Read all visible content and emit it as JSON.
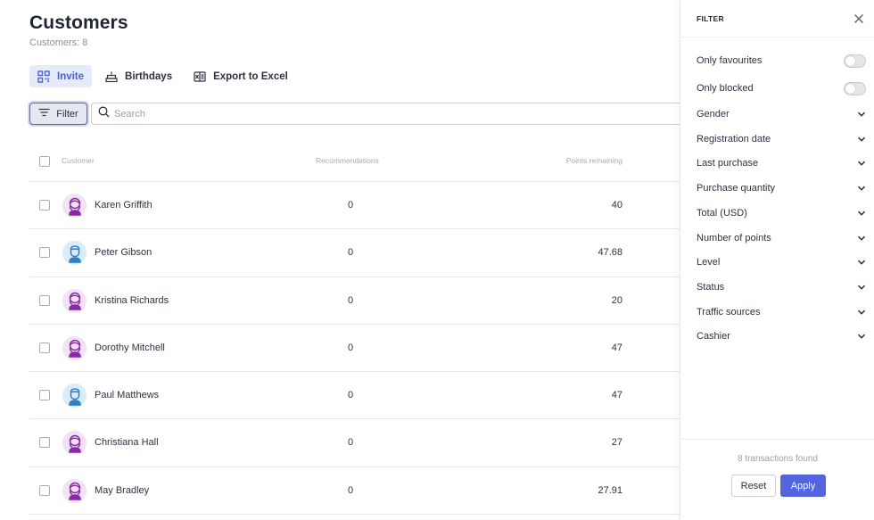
{
  "header": {
    "title": "Customers",
    "subtitle": "Customers: 8"
  },
  "toolbar": {
    "invite_label": "Invite",
    "birthdays_label": "Birthdays",
    "export_label": "Export to Excel"
  },
  "filter_button": {
    "label": "Filter"
  },
  "search": {
    "placeholder": "Search",
    "value": ""
  },
  "table": {
    "columns": [
      "Customer",
      "Recommendations",
      "Points remaining"
    ],
    "rows": [
      {
        "name": "Karen Griffith",
        "recommendations": "0",
        "points": "40",
        "avatar": "female-avatar-icon"
      },
      {
        "name": "Peter Gibson",
        "recommendations": "0",
        "points": "47.68",
        "avatar": "male-avatar-icon"
      },
      {
        "name": "Kristina Richards",
        "recommendations": "0",
        "points": "20",
        "avatar": "female-avatar-icon"
      },
      {
        "name": "Dorothy Mitchell",
        "recommendations": "0",
        "points": "47",
        "avatar": "female-avatar-icon"
      },
      {
        "name": "Paul Matthews",
        "recommendations": "0",
        "points": "47",
        "avatar": "male-avatar-icon"
      },
      {
        "name": "Christiana Hall",
        "recommendations": "0",
        "points": "27",
        "avatar": "female-avatar-icon"
      },
      {
        "name": "May Bradley",
        "recommendations": "0",
        "points": "27.91",
        "avatar": "female-avatar-icon"
      }
    ]
  },
  "filter_panel": {
    "title": "FILTER",
    "toggles": [
      {
        "label": "Only favourites",
        "on": false
      },
      {
        "label": "Only blocked",
        "on": false
      }
    ],
    "sections": [
      "Gender",
      "Registration date",
      "Last purchase",
      "Purchase quantity",
      "Total (USD)",
      "Number of points",
      "Level",
      "Status",
      "Traffic sources",
      "Cashier"
    ],
    "found_text": "8 transactions found",
    "reset_label": "Reset",
    "apply_label": "Apply"
  },
  "colors": {
    "accent": "#5264e0",
    "active_tab_bg": "#e6ebfb",
    "female_avatar": "#8b2aa8",
    "male_avatar": "#2f7fc4"
  }
}
